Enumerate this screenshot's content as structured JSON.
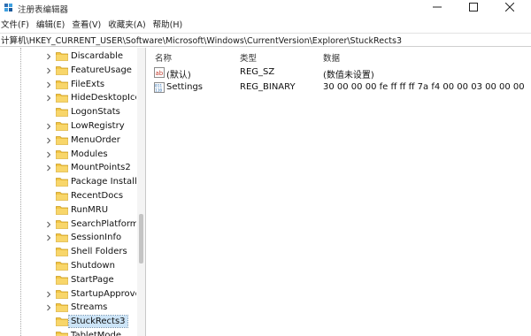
{
  "window": {
    "title": "注册表编辑器",
    "controls": {
      "minimize": "minimize-icon",
      "maximize": "maximize-icon",
      "close": "close-icon"
    }
  },
  "menu": [
    "文件(F)",
    "编辑(E)",
    "查看(V)",
    "收藏夹(A)",
    "帮助(H)"
  ],
  "address": "计算机\\HKEY_CURRENT_USER\\Software\\Microsoft\\Windows\\CurrentVersion\\Explorer\\StuckRects3",
  "tree": {
    "items": [
      {
        "label": "Discardable",
        "expandable": true
      },
      {
        "label": "FeatureUsage",
        "expandable": true
      },
      {
        "label": "FileExts",
        "expandable": true
      },
      {
        "label": "HideDesktopIco",
        "expandable": true
      },
      {
        "label": "LogonStats",
        "expandable": false
      },
      {
        "label": "LowRegistry",
        "expandable": true
      },
      {
        "label": "MenuOrder",
        "expandable": true
      },
      {
        "label": "Modules",
        "expandable": true
      },
      {
        "label": "MountPoints2",
        "expandable": true
      },
      {
        "label": "Package Installa",
        "expandable": false
      },
      {
        "label": "RecentDocs",
        "expandable": false
      },
      {
        "label": "RunMRU",
        "expandable": false
      },
      {
        "label": "SearchPlatform",
        "expandable": true
      },
      {
        "label": "SessionInfo",
        "expandable": true
      },
      {
        "label": "Shell Folders",
        "expandable": false
      },
      {
        "label": "Shutdown",
        "expandable": false
      },
      {
        "label": "StartPage",
        "expandable": false
      },
      {
        "label": "StartupApprove",
        "expandable": true
      },
      {
        "label": "Streams",
        "expandable": true
      },
      {
        "label": "StuckRects3",
        "expandable": false,
        "selected": true
      },
      {
        "label": "TabletMode",
        "expandable": false
      }
    ]
  },
  "values": {
    "headers": {
      "name": "名称",
      "type": "类型",
      "data": "数据"
    },
    "rows": [
      {
        "icon": "string-value-icon",
        "name": "(默认)",
        "type": "REG_SZ",
        "data": "(数值未设置)"
      },
      {
        "icon": "binary-value-icon",
        "name": "Settings",
        "type": "REG_BINARY",
        "data": "30 00 00 00 fe ff ff ff 7a f4 00 00 03 00 00 00 ..."
      }
    ]
  },
  "colors": {
    "folder": "#f3c544",
    "selection": "#cce4f7",
    "string_icon": "#c0392b",
    "binary_icon": "#2e6fb3"
  }
}
